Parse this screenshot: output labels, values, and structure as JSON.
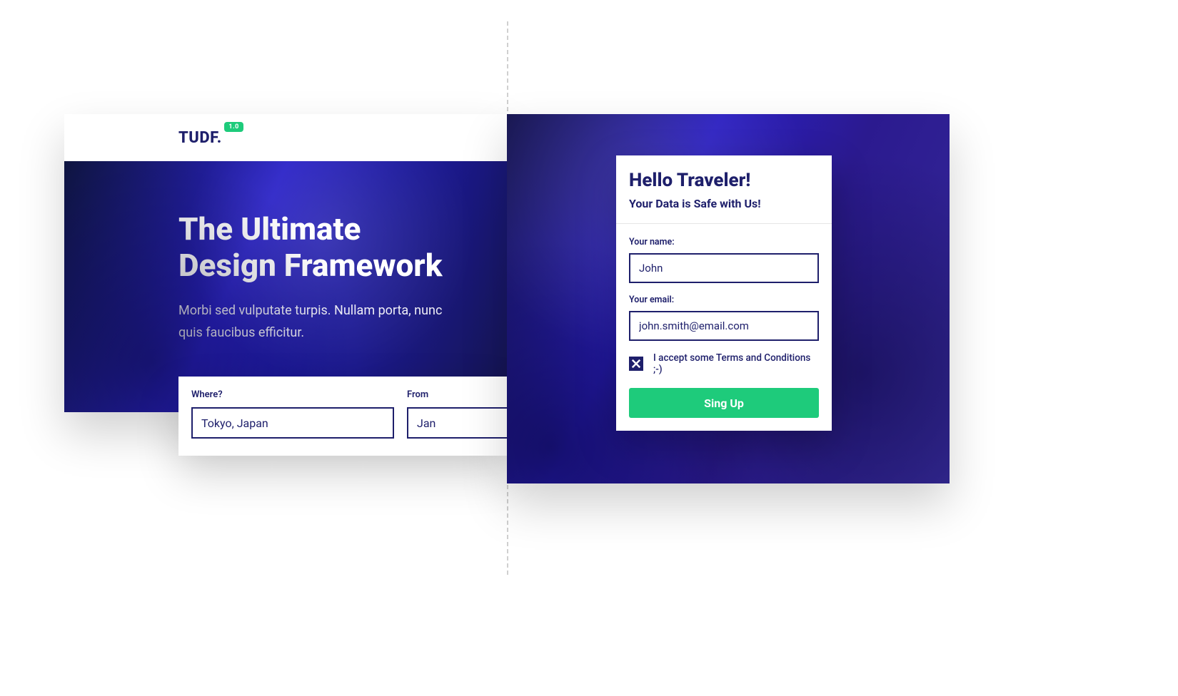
{
  "colors": {
    "primary": "#1e1f6b",
    "accent": "#1ecb7b",
    "heroBg": "#2a22c7"
  },
  "left": {
    "logo": "TUDF.",
    "version": "1.0",
    "heroTitleLine1": "The Ultimate",
    "heroTitleLine2": "Design Framework",
    "heroSub": "Morbi sed vulputate turpis. Nullam porta, nunc quis faucibus efficitur.",
    "search": {
      "whereLabel": "Where?",
      "whereValue": "Tokyo, Japan",
      "fromLabel": "From",
      "fromValue": "Jan"
    }
  },
  "right": {
    "title": "Hello Traveler!",
    "subtitle": "Your Data is Safe with Us!",
    "nameLabel": "Your name:",
    "nameValue": "John",
    "emailLabel": "Your email:",
    "emailValue": "john.smith@email.com",
    "termsChecked": true,
    "termsText": "I accept some Terms and Conditions ;-)",
    "buttonLabel": "Sing Up"
  }
}
